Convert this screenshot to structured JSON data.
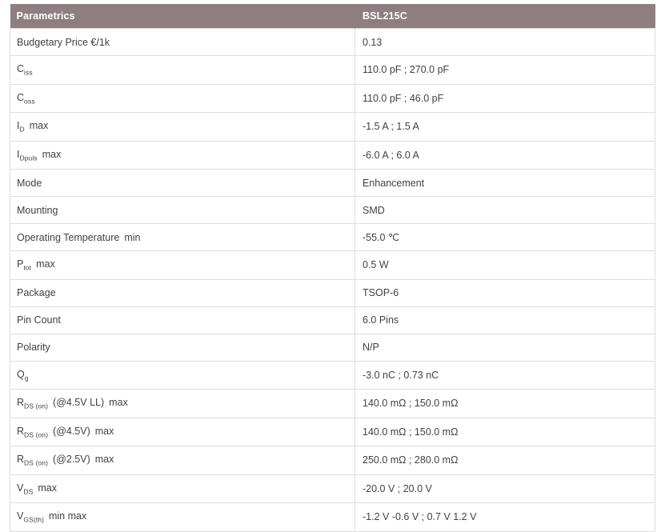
{
  "table": {
    "columns": [
      {
        "key": "parametric",
        "label": "Parametrics"
      },
      {
        "key": "value",
        "label": "BSL215C"
      }
    ],
    "header_bg": "#8e7e80",
    "header_text_color": "#ffffff",
    "border_color": "#dedede",
    "rows": [
      {
        "parametric_plain": "Budgetary Price €/1k",
        "parametric_base": "Budgetary Price €/1k",
        "parametric_sub": "",
        "parametric_qualifier": "",
        "value": "0.13"
      },
      {
        "parametric_plain": "Ciss",
        "parametric_base": "C",
        "parametric_sub": "iss",
        "parametric_qualifier": "",
        "value": "110.0 pF ; 270.0 pF"
      },
      {
        "parametric_plain": "Coss",
        "parametric_base": "C",
        "parametric_sub": "oss",
        "parametric_qualifier": "",
        "value": "110.0 pF ; 46.0 pF"
      },
      {
        "parametric_plain": "ID max",
        "parametric_base": "I",
        "parametric_sub": "D",
        "parametric_qualifier": "max",
        "value": "-1.5 A ; 1.5 A"
      },
      {
        "parametric_plain": "IDpuls max",
        "parametric_base": "I",
        "parametric_sub": "Dpuls",
        "parametric_qualifier": "max",
        "value": "-6.0 A ; 6.0 A"
      },
      {
        "parametric_plain": "Mode",
        "parametric_base": "Mode",
        "parametric_sub": "",
        "parametric_qualifier": "",
        "value": "Enhancement"
      },
      {
        "parametric_plain": "Mounting",
        "parametric_base": "Mounting",
        "parametric_sub": "",
        "parametric_qualifier": "",
        "value": "SMD"
      },
      {
        "parametric_plain": "Operating Temperature min",
        "parametric_base": "Operating Temperature",
        "parametric_sub": "",
        "parametric_qualifier": "min",
        "value": "-55.0 ℃"
      },
      {
        "parametric_plain": "Ptot max",
        "parametric_base": "P",
        "parametric_sub": "tot",
        "parametric_qualifier": "max",
        "value": "0.5 W"
      },
      {
        "parametric_plain": "Package",
        "parametric_base": "Package",
        "parametric_sub": "",
        "parametric_qualifier": "",
        "value": "TSOP-6"
      },
      {
        "parametric_plain": "Pin Count",
        "parametric_base": "Pin Count",
        "parametric_sub": "",
        "parametric_qualifier": "",
        "value": "6.0 Pins"
      },
      {
        "parametric_plain": "Polarity",
        "parametric_base": "Polarity",
        "parametric_sub": "",
        "parametric_qualifier": "",
        "value": "N/P"
      },
      {
        "parametric_plain": "Qg",
        "parametric_base": "Q",
        "parametric_sub": "g",
        "parametric_qualifier": "",
        "value": "-3.0 nC ; 0.73 nC"
      },
      {
        "parametric_plain": "RDS (on) (@4.5V LL) max",
        "parametric_base": "R",
        "parametric_sub": "DS (on)",
        "parametric_suffix": "(@4.5V LL)",
        "parametric_qualifier": "max",
        "value": "140.0 mΩ ; 150.0 mΩ"
      },
      {
        "parametric_plain": "RDS (on) (@4.5V) max",
        "parametric_base": "R",
        "parametric_sub": "DS (on)",
        "parametric_suffix": "(@4.5V)",
        "parametric_qualifier": "max",
        "value": "140.0 mΩ ; 150.0 mΩ"
      },
      {
        "parametric_plain": "RDS (on) (@2.5V) max",
        "parametric_base": "R",
        "parametric_sub": "DS (on)",
        "parametric_suffix": "(@2.5V)",
        "parametric_qualifier": "max",
        "value": "250.0 mΩ ; 280.0 mΩ"
      },
      {
        "parametric_plain": "VDS max",
        "parametric_base": "V",
        "parametric_sub": "DS",
        "parametric_qualifier": "max",
        "value": "-20.0 V ; 20.0 V"
      },
      {
        "parametric_plain": "VGS(th) min max",
        "parametric_base": "V",
        "parametric_sub": "GS(th)",
        "parametric_qualifier": "min  max",
        "value": "-1.2 V  -0.6 V ; 0.7 V  1.2 V"
      }
    ]
  }
}
